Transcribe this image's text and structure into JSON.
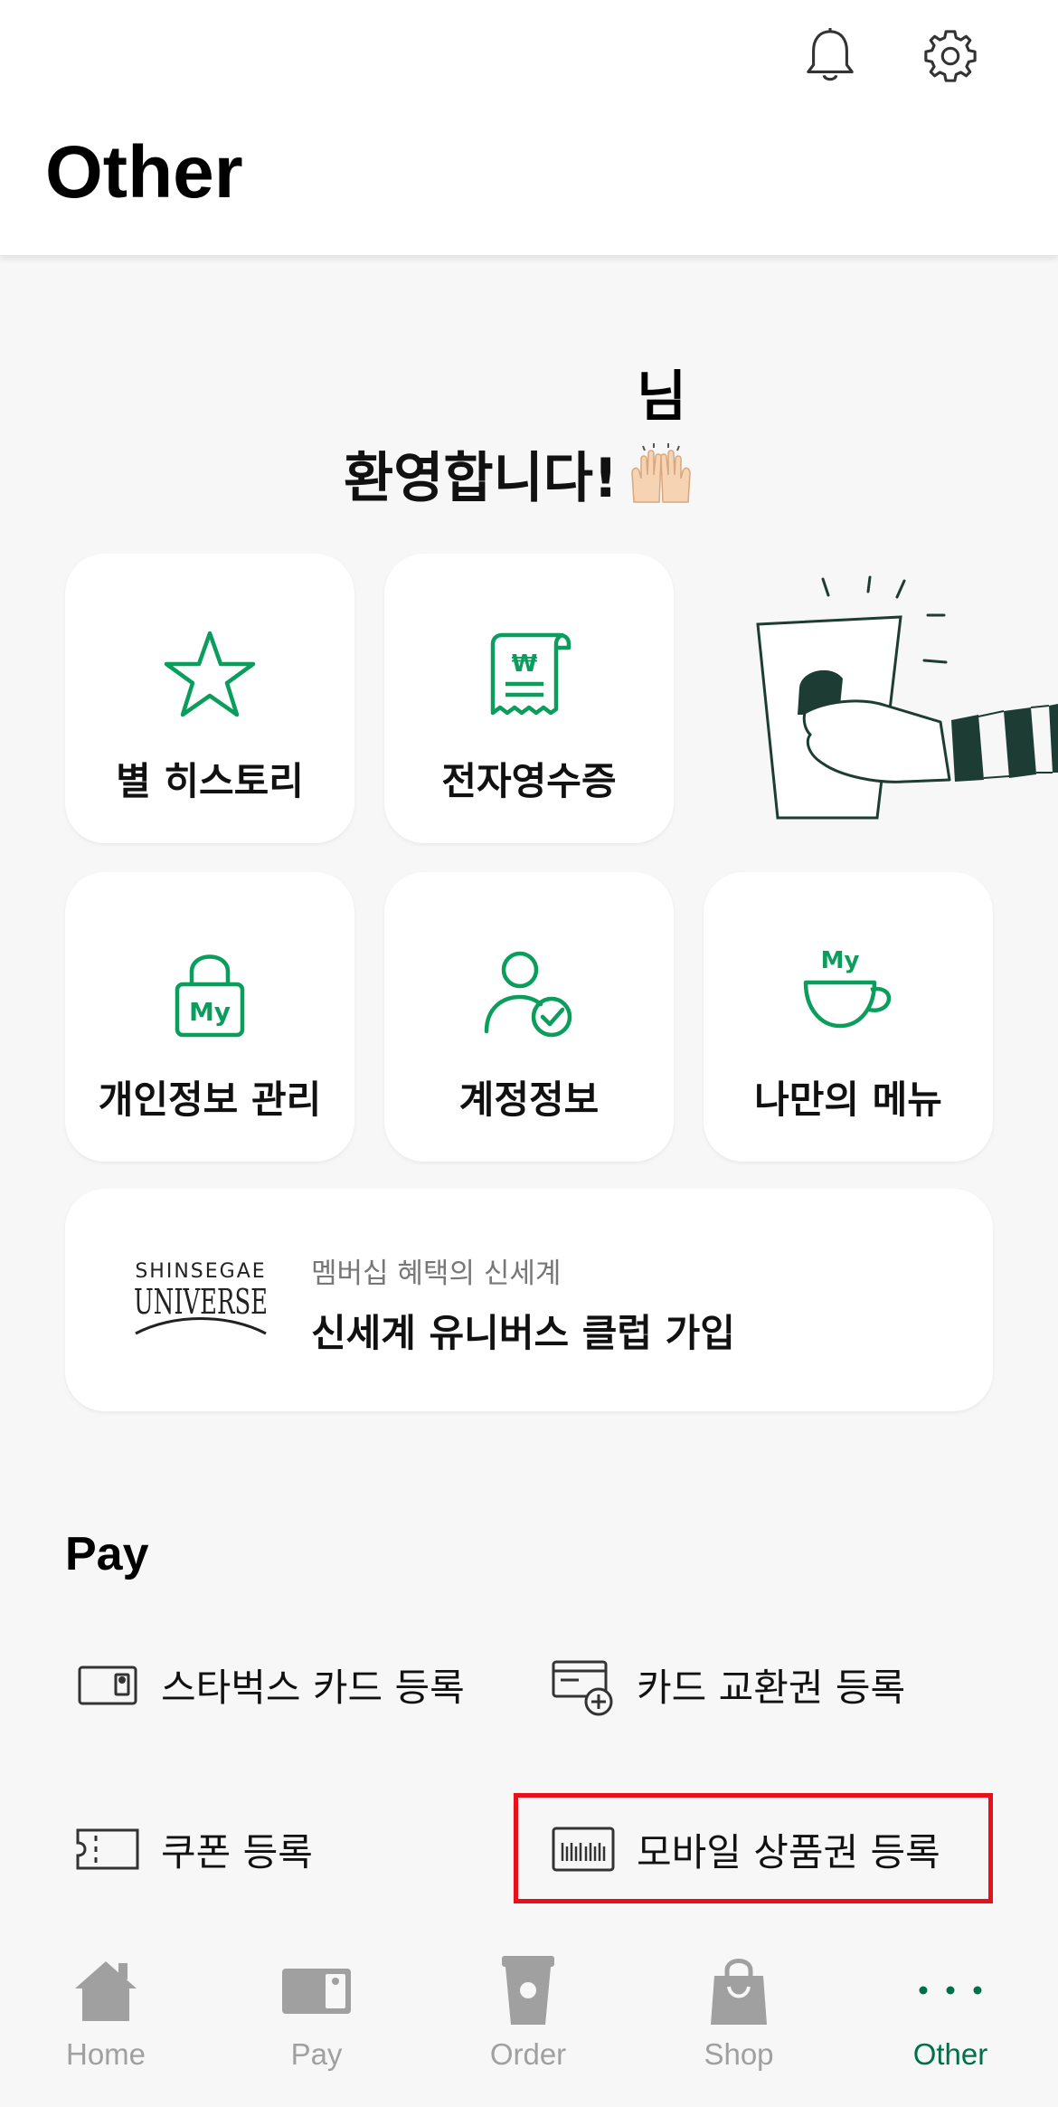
{
  "header": {
    "title": "Other",
    "notification_icon": "bell-icon",
    "settings_icon": "gear-icon"
  },
  "welcome": {
    "name_suffix": "님",
    "greeting": "환영합니다!",
    "emoji": "raising-hands"
  },
  "tiles": {
    "star_history": {
      "label": "별 히스토리",
      "icon": "star-icon"
    },
    "e_receipt": {
      "label": "전자영수증",
      "icon": "receipt-icon"
    },
    "privacy": {
      "label": "개인정보 관리",
      "icon": "lock-my-icon"
    },
    "account": {
      "label": "계정정보",
      "icon": "user-check-icon"
    },
    "my_menu": {
      "label": "나만의 메뉴",
      "icon": "cup-my-icon"
    }
  },
  "universe": {
    "logo_line1": "SHINSEGAE",
    "logo_line2": "UNIVERSE",
    "subtitle": "멤버십 혜택의 신세계",
    "title": "신세계 유니버스 클럽 가입"
  },
  "pay": {
    "section_title": "Pay",
    "items": [
      {
        "label": "스타벅스 카드 등록",
        "icon": "card-icon"
      },
      {
        "label": "카드 교환권 등록",
        "icon": "card-add-icon"
      },
      {
        "label": "쿠폰 등록",
        "icon": "coupon-icon"
      },
      {
        "label": "모바일 상품권 등록",
        "icon": "barcode-voucher-icon"
      }
    ]
  },
  "tabbar": {
    "tabs": [
      {
        "label": "Home",
        "icon": "home-icon"
      },
      {
        "label": "Pay",
        "icon": "pay-card-icon"
      },
      {
        "label": "Order",
        "icon": "cup-icon"
      },
      {
        "label": "Shop",
        "icon": "shopping-bag-icon"
      },
      {
        "label": "Other",
        "icon": "more-dots-icon"
      }
    ],
    "active_tab": "Other"
  },
  "colors": {
    "brand_green": "#00704a",
    "icon_green": "#0a9d5c",
    "highlight_red": "#e8101a",
    "inactive_gray": "#a0a0a0"
  }
}
